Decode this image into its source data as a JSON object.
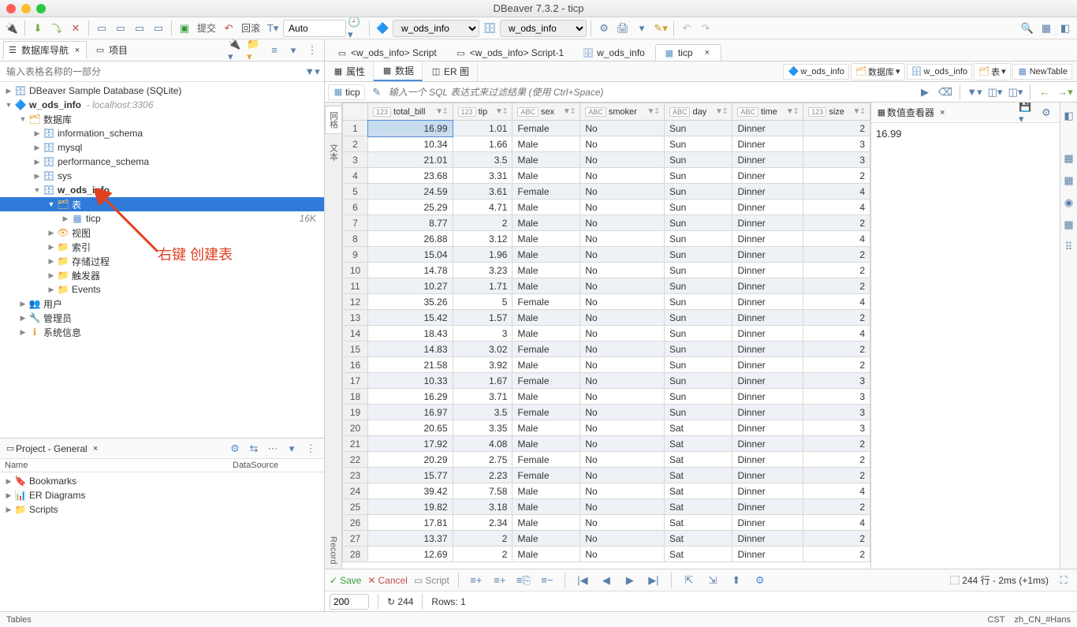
{
  "window_title": "DBeaver 7.3.2 - ticp",
  "toolbar": {
    "commit": "提交",
    "rollback": "回滚",
    "auto": "Auto",
    "conn_dd": "w_ods_info",
    "db_dd": "w_ods_info"
  },
  "nav": {
    "tab1": "数据库导航",
    "tab2": "项目",
    "filter_placeholder": "输入表格名称的一部分",
    "tree": {
      "sample": "DBeaver Sample Database (SQLite)",
      "conn": "w_ods_info",
      "host": "- localhost:3306",
      "databases": "数据库",
      "info_schema": "information_schema",
      "mysql": "mysql",
      "perf_schema": "performance_schema",
      "sys": "sys",
      "w_ods_info": "w_ods_info",
      "tables": "表",
      "ticp": "ticp",
      "ticp_size": "16K",
      "views": "视图",
      "indexes": "索引",
      "procs": "存储过程",
      "triggers": "触发器",
      "events": "Events",
      "users": "用户",
      "admin": "管理员",
      "sysinfo": "系统信息"
    },
    "annotation": "右键 创建表"
  },
  "project": {
    "title": "Project - General",
    "col1": "Name",
    "col2": "DataSource",
    "bookmarks": "Bookmarks",
    "er": "ER Diagrams",
    "scripts": "Scripts"
  },
  "editor": {
    "tabs": [
      "<w_ods_info> Script",
      "<w_ods_info> Script-1",
      "w_ods_info",
      "ticp"
    ],
    "subtabs": {
      "props": "属性",
      "data": "数据",
      "er": "ER 图"
    },
    "breadcrumb": {
      "conn": "w_ods_info",
      "db": "数据库",
      "schema": "w_ods_info",
      "tables": "表",
      "new": "NewTable"
    },
    "table_chip": "ticp",
    "sql_placeholder": "输入一个 SQL 表达式来过滤结果 (使用 Ctrl+Space)",
    "columns": [
      {
        "name": "total_bill",
        "type": "123"
      },
      {
        "name": "tip",
        "type": "123"
      },
      {
        "name": "sex",
        "type": "ABC"
      },
      {
        "name": "smoker",
        "type": "ABC"
      },
      {
        "name": "day",
        "type": "ABC"
      },
      {
        "name": "time",
        "type": "ABC"
      },
      {
        "name": "size",
        "type": "123"
      }
    ],
    "rows": [
      [
        16.99,
        1.01,
        "Female",
        "No",
        "Sun",
        "Dinner",
        2
      ],
      [
        10.34,
        1.66,
        "Male",
        "No",
        "Sun",
        "Dinner",
        3
      ],
      [
        21.01,
        3.5,
        "Male",
        "No",
        "Sun",
        "Dinner",
        3
      ],
      [
        23.68,
        3.31,
        "Male",
        "No",
        "Sun",
        "Dinner",
        2
      ],
      [
        24.59,
        3.61,
        "Female",
        "No",
        "Sun",
        "Dinner",
        4
      ],
      [
        25.29,
        4.71,
        "Male",
        "No",
        "Sun",
        "Dinner",
        4
      ],
      [
        8.77,
        2,
        "Male",
        "No",
        "Sun",
        "Dinner",
        2
      ],
      [
        26.88,
        3.12,
        "Male",
        "No",
        "Sun",
        "Dinner",
        4
      ],
      [
        15.04,
        1.96,
        "Male",
        "No",
        "Sun",
        "Dinner",
        2
      ],
      [
        14.78,
        3.23,
        "Male",
        "No",
        "Sun",
        "Dinner",
        2
      ],
      [
        10.27,
        1.71,
        "Male",
        "No",
        "Sun",
        "Dinner",
        2
      ],
      [
        35.26,
        5,
        "Female",
        "No",
        "Sun",
        "Dinner",
        4
      ],
      [
        15.42,
        1.57,
        "Male",
        "No",
        "Sun",
        "Dinner",
        2
      ],
      [
        18.43,
        3,
        "Male",
        "No",
        "Sun",
        "Dinner",
        4
      ],
      [
        14.83,
        3.02,
        "Female",
        "No",
        "Sun",
        "Dinner",
        2
      ],
      [
        21.58,
        3.92,
        "Male",
        "No",
        "Sun",
        "Dinner",
        2
      ],
      [
        10.33,
        1.67,
        "Female",
        "No",
        "Sun",
        "Dinner",
        3
      ],
      [
        16.29,
        3.71,
        "Male",
        "No",
        "Sun",
        "Dinner",
        3
      ],
      [
        16.97,
        3.5,
        "Female",
        "No",
        "Sun",
        "Dinner",
        3
      ],
      [
        20.65,
        3.35,
        "Male",
        "No",
        "Sat",
        "Dinner",
        3
      ],
      [
        17.92,
        4.08,
        "Male",
        "No",
        "Sat",
        "Dinner",
        2
      ],
      [
        20.29,
        2.75,
        "Female",
        "No",
        "Sat",
        "Dinner",
        2
      ],
      [
        15.77,
        2.23,
        "Female",
        "No",
        "Sat",
        "Dinner",
        2
      ],
      [
        39.42,
        7.58,
        "Male",
        "No",
        "Sat",
        "Dinner",
        4
      ],
      [
        19.82,
        3.18,
        "Male",
        "No",
        "Sat",
        "Dinner",
        2
      ],
      [
        17.81,
        2.34,
        "Male",
        "No",
        "Sat",
        "Dinner",
        4
      ],
      [
        13.37,
        2,
        "Male",
        "No",
        "Sat",
        "Dinner",
        2
      ],
      [
        12.69,
        2,
        "Male",
        "No",
        "Sat",
        "Dinner",
        2
      ]
    ],
    "gutter": {
      "grid": "网格",
      "text": "文本",
      "record": "Record"
    },
    "footer": {
      "save": "Save",
      "cancel": "Cancel",
      "script": "Script",
      "status": "244 行 - 2ms (+1ms)"
    },
    "pager": {
      "limit": "200",
      "refresh": "244",
      "rows": "Rows: 1"
    }
  },
  "value_panel": {
    "title": "数值查看器",
    "value": "16.99"
  },
  "statusbar": {
    "left": "Tables",
    "tz": "CST",
    "locale": "zh_CN_#Hans"
  }
}
